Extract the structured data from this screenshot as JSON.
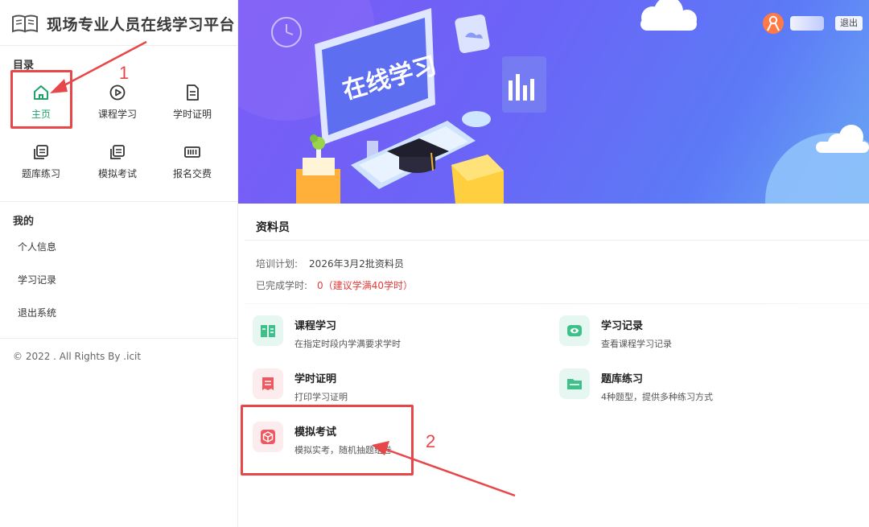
{
  "app": {
    "title": "现场专业人员在线学习平台"
  },
  "sidebar": {
    "catalog_label": "目录",
    "menu": [
      {
        "label": "主页",
        "icon": "home-icon",
        "active": true
      },
      {
        "label": "课程学习",
        "icon": "play-circle-icon",
        "active": false
      },
      {
        "label": "学时证明",
        "icon": "document-icon",
        "active": false
      },
      {
        "label": "题库练习",
        "icon": "question-bank-icon",
        "active": false
      },
      {
        "label": "模拟考试",
        "icon": "mock-exam-icon",
        "active": false
      },
      {
        "label": "报名交费",
        "icon": "register-pay-icon",
        "active": false
      }
    ],
    "mine_label": "我的",
    "mine_items": [
      {
        "label": "个人信息"
      },
      {
        "label": "学习记录"
      },
      {
        "label": "退出系统"
      }
    ],
    "copyright": "© 2022 . All Rights By .icit"
  },
  "header": {
    "banner_text": "在线学习",
    "logout_label": "退出"
  },
  "main": {
    "role": "资料员",
    "plan_label": "培训计划:",
    "plan_value": "2026年3月2批资料员",
    "hours_label": "已完成学时:",
    "hours_value": "0",
    "hours_hint": "（建议学满40学时）",
    "features": [
      {
        "title": "课程学习",
        "desc": "在指定时段内学满要求学时",
        "icon": "book-open-icon"
      },
      {
        "title": "学习记录",
        "desc": "查看课程学习记录",
        "icon": "eye-icon"
      },
      {
        "title": "学时证明",
        "desc": "打印学习证明",
        "icon": "certificate-icon"
      },
      {
        "title": "题库练习",
        "desc": "4种题型，提供多种练习方式",
        "icon": "folder-icon"
      },
      {
        "title": "模拟考试",
        "desc": "模拟实考，随机抽题组卷",
        "icon": "cube-icon"
      }
    ]
  },
  "annotations": {
    "step1": "1",
    "step2": "2"
  },
  "colors": {
    "accent_green": "#1ea36b",
    "annotation_red": "#e8474a",
    "banner_purple": "#6c63f7",
    "warning_red": "#e53a3a"
  }
}
